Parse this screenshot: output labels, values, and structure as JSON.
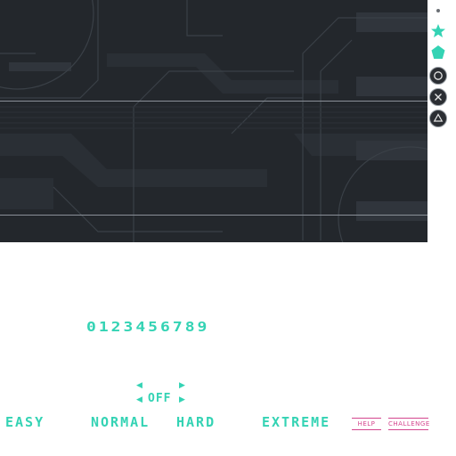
{
  "icons": [
    {
      "name": "dot-icon",
      "color": "#6b6f75"
    },
    {
      "name": "star-icon",
      "color": "#34d3b4"
    },
    {
      "name": "pentagon-icon",
      "color": "#34d3b4"
    },
    {
      "name": "circle-button-icon",
      "color": "#2b2e33"
    },
    {
      "name": "cross-button-icon",
      "color": "#2b2e33"
    },
    {
      "name": "triangle-button-icon",
      "color": "#2b2e33"
    }
  ],
  "digits": "0123456789",
  "option": {
    "value": "OFF"
  },
  "difficulty": {
    "easy": "EASY",
    "normal": "NORMAL",
    "hard": "HARD",
    "extreme": "EXTREME"
  },
  "buttons": {
    "help": "HELP",
    "challenge": "CHALLENGE"
  },
  "colors": {
    "accent": "#34d3b4",
    "pink": "#d4468e",
    "banner": "#23272c"
  }
}
